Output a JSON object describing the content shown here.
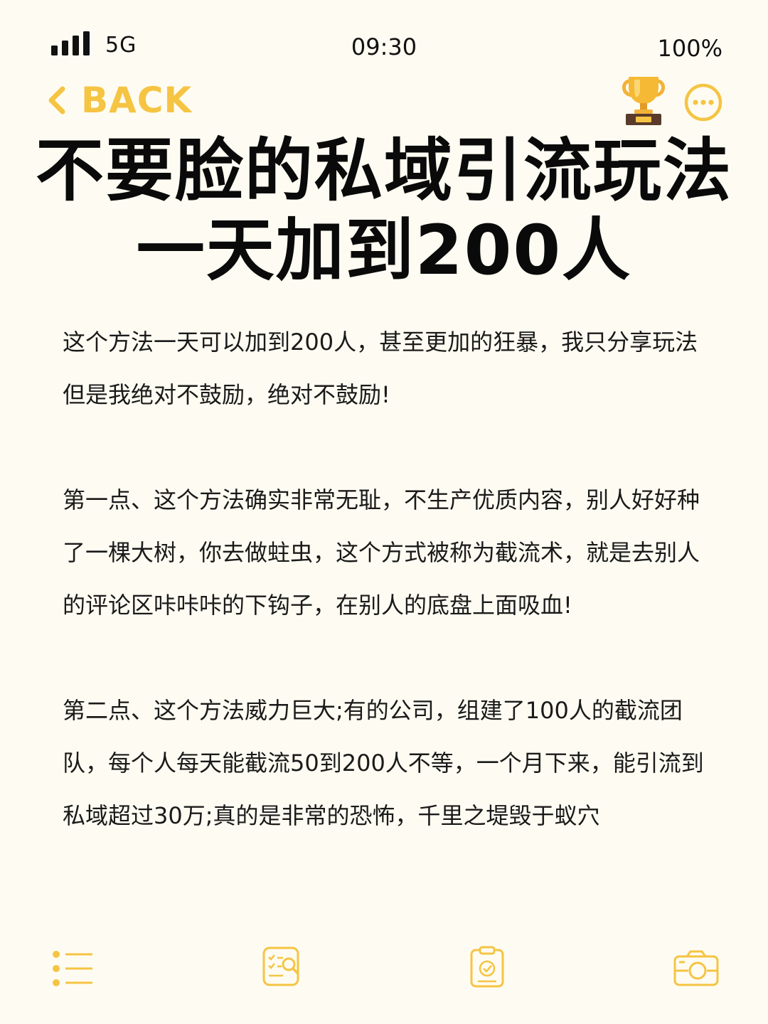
{
  "status_bar": {
    "network": "5G",
    "time": "09:30",
    "battery": "100%"
  },
  "nav": {
    "back_label": "BACK",
    "icons": [
      "chevron-left-icon",
      "trophy-icon",
      "more-icon"
    ]
  },
  "title": {
    "line1": "不要脸的私域引流玩法",
    "line2": "一天加到200人"
  },
  "paragraphs": [
    "这个方法一天可以加到200人，甚至更加的狂暴，我只分享玩法但是我绝对不鼓励，绝对不鼓励!",
    "第一点、这个方法确实非常无耻，不生产优质内容，别人好好种了一棵大树，你去做蛀虫，这个方式被称为截流术，就是去别人的评论区咔咔咔的下钩子，在别人的底盘上面吸血!",
    "第二点、这个方法威力巨大;有的公司，组建了100人的截流团队，每个人每天能截流50到200人不等，一个月下来，能引流到私域超过30万;真的是非常的恐怖，千里之堤毁于蚁穴"
  ],
  "bottom_bar": {
    "icons": [
      "list-icon",
      "checklist-search-icon",
      "clipboard-check-icon",
      "camera-icon"
    ]
  },
  "colors": {
    "background": "#FEFCF2",
    "accent": "#F5C443",
    "text": "#111111"
  }
}
